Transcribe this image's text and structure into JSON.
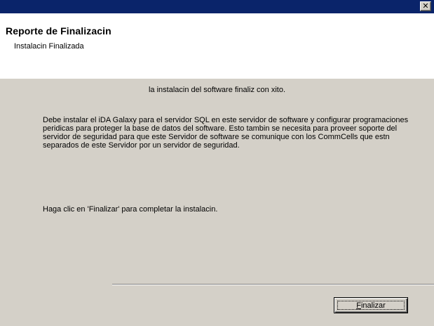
{
  "window": {
    "close_glyph": "✕"
  },
  "header": {
    "title": "Reporte de Finalizacin",
    "subtitle": "Instalacin Finalizada"
  },
  "body": {
    "main_message": "la instalacin del software finaliz con xito.",
    "info_paragraph": "Debe instalar el iDA Galaxy para el servidor SQL en este servidor de software y configurar programaciones peridicas para proteger la base de datos del software. Esto tambin se necesita para proveer soporte del servidor de seguridad para que este Servidor de software se comunique con los CommCells que estn separados de este Servidor por un servidor de seguridad.",
    "click_message": "Haga clic en 'Finalizar' para completar la instalacin."
  },
  "buttons": {
    "finish_accel": "F",
    "finish_rest": "inalizar"
  }
}
